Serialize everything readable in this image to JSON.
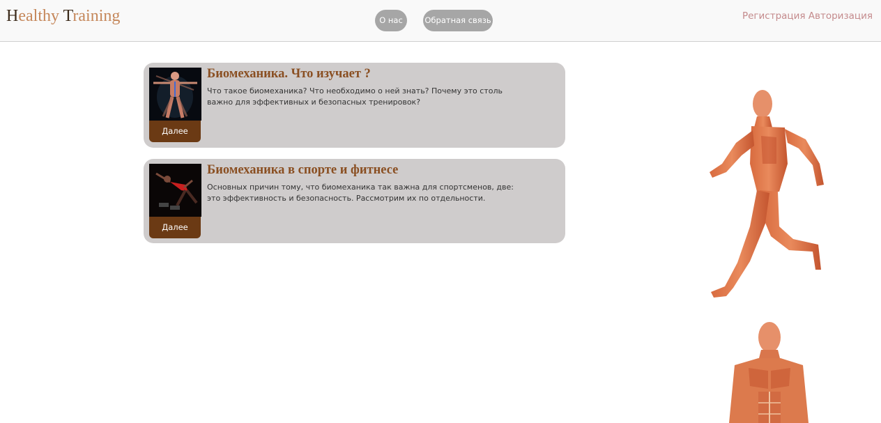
{
  "header": {
    "logo_h": "H",
    "logo_part1": "ealthy ",
    "logo_t": "T",
    "logo_part2": "raining",
    "nav": {
      "about_label": "О нас",
      "feedback_label": "Обратная связь"
    },
    "auth": {
      "register_label": "Регистрация",
      "login_label": "Авторизация"
    }
  },
  "articles": [
    {
      "title": "Биомеханика. Что изучает ?",
      "text": "Что такое биомеханика? Что необходимо о ней знать? Почему это столь важно для эффективных и безопасных тренировок?",
      "button_label": "Далее",
      "image_icon": "anatomy-vitruvian-icon"
    },
    {
      "title": "Биомеханика в спорте и фитнесе",
      "text": "Основных причин тому, что биомеханика так важна для спортсменов, две: это эффективность и безопасность. Рассмотрим их по отдельности.",
      "button_label": "Далее",
      "image_icon": "sprinter-icon"
    }
  ],
  "colors": {
    "logo": "#c5875a",
    "logo_caps": "#3b2a1a",
    "nav_button": "#a6a6a6",
    "auth_link": "#c48a8c",
    "card_bg": "#cfcccc",
    "card_title": "#8a4f22",
    "more_button": "#6b3a14"
  }
}
